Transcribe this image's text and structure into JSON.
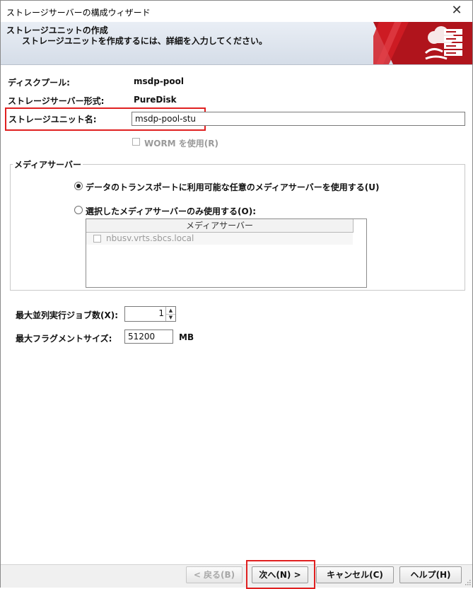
{
  "window": {
    "title": "ストレージサーバーの構成ウィザード"
  },
  "header": {
    "title": "ストレージユニットの作成",
    "subtitle": "ストレージユニットを作成するには、詳細を入力してください。"
  },
  "form": {
    "disk_pool_label": "ディスクプール:",
    "disk_pool_value": "msdp-pool",
    "server_type_label": "ストレージサーバー形式:",
    "server_type_value": "PureDisk",
    "unit_name_label": "ストレージユニット名:",
    "unit_name_value": "msdp-pool-stu",
    "worm_label": "WORM を使用(R)"
  },
  "media_group": {
    "title": "メディアサーバー",
    "option_any": "データのトランスポートに利用可能な任意のメディアサーバーを使用する(U)",
    "option_selected": "選択したメディアサーバーのみ使用する(O):",
    "table_header": "メディアサーバー",
    "rows": [
      "nbusv.vrts.sbcs.local"
    ]
  },
  "limits": {
    "max_jobs_label": "最大並列実行ジョブ数(X):",
    "max_jobs_value": "1",
    "max_fragment_label": "最大フラグメントサイズ:",
    "max_fragment_value": "51200",
    "max_fragment_unit": "MB"
  },
  "buttons": {
    "back": "< 戻る(B)",
    "next": "次へ(N) >",
    "cancel": "キャンセル(C)",
    "help": "ヘルプ(H)"
  },
  "icons": [
    "close-icon",
    "cloud-server-logo",
    "spinner-up-icon",
    "spinner-down-icon",
    "resize-grip-icon"
  ],
  "colors": {
    "highlight": "#e02020",
    "logo_red": "#b0141c",
    "header_bg": "#dde4ee"
  }
}
